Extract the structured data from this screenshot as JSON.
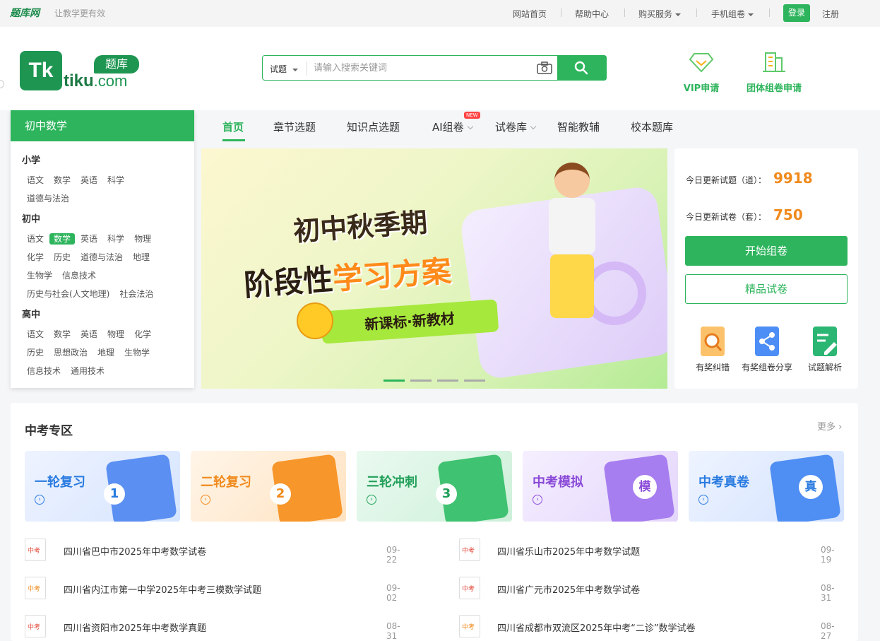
{
  "topbar": {
    "logo": "题库网",
    "slogan": "让教学更有效",
    "nav": [
      "网站首页",
      "帮助中心",
      "购买服务",
      "手机组卷"
    ],
    "login": "登录",
    "register": "注册"
  },
  "header": {
    "brand_bubble": "题库",
    "brand_word": "tiku",
    "brand_domain": ".com",
    "search_type": "试题",
    "search_placeholder": "请输入搜索关键词",
    "links": [
      "VIP申请",
      "团体组卷申请"
    ]
  },
  "sidebar": {
    "current": "初中数学",
    "groups": [
      {
        "name": "小学",
        "rows": [
          [
            "语文",
            "数学",
            "英语",
            "科学"
          ],
          [
            "道德与法治"
          ]
        ]
      },
      {
        "name": "初中",
        "rows": [
          [
            "语文",
            "数学",
            "英语",
            "科学",
            "物理"
          ],
          [
            "化学",
            "历史",
            "道德与法治",
            "地理"
          ],
          [
            "生物学",
            "信息技术"
          ],
          [
            "历史与社会(人文地理)",
            "社会法治"
          ]
        ]
      },
      {
        "name": "高中",
        "rows": [
          [
            "语文",
            "数学",
            "英语",
            "物理",
            "化学"
          ],
          [
            "历史",
            "思想政治",
            "地理",
            "生物学"
          ],
          [
            "信息技术",
            "通用技术"
          ]
        ]
      }
    ],
    "selected": "数学"
  },
  "mainnav": {
    "items": [
      "首页",
      "章节选题",
      "知识点选题",
      "AI组卷",
      "试卷库",
      "智能教辅",
      "校本题库"
    ],
    "active": "首页",
    "new_badge": "NEW"
  },
  "banner": {
    "line1": "初中秋季期",
    "line2a": "阶段性",
    "line2b": "学习方案",
    "tag": "新课标·新教材"
  },
  "stats": {
    "today_questions_label": "今日更新试题（道）：",
    "today_questions_value": "9918",
    "today_papers_label": "今日更新试卷（套）：",
    "today_papers_value": "750",
    "start_button": "开始组卷",
    "quality_button": "精品试卷",
    "tools": [
      "有奖纠错",
      "有奖组卷分享",
      "试题解析"
    ]
  },
  "zhongkao": {
    "title": "中考专区",
    "more": "更多",
    "cards": [
      {
        "label": "一轮复习",
        "badge": "1",
        "color": "#2a7be0"
      },
      {
        "label": "二轮复习",
        "badge": "2",
        "color": "#f08a1c"
      },
      {
        "label": "三轮冲刺",
        "badge": "3",
        "color": "#22a05a"
      },
      {
        "label": "中考模拟",
        "badge": "模",
        "color": "#8a4ad8"
      },
      {
        "label": "中考真卷",
        "badge": "真",
        "color": "#2a7be0"
      }
    ],
    "icon_text": "中考",
    "papers_left": [
      {
        "title": "四川省巴中市2025年中考数学试卷",
        "date": "09-22"
      },
      {
        "title": "四川省内江市第一中学2025年中考三模数学试题",
        "date": "09-02"
      },
      {
        "title": "四川省资阳市2025年中考数学真题",
        "date": "08-31"
      }
    ],
    "papers_right": [
      {
        "title": "四川省乐山市2025年中考数学试题",
        "date": "09-19"
      },
      {
        "title": "四川省广元市2025年中考数学试卷",
        "date": "08-31"
      },
      {
        "title": "四川省成都市双流区2025年中考“二诊”数学试卷",
        "date": "08-27"
      }
    ]
  }
}
